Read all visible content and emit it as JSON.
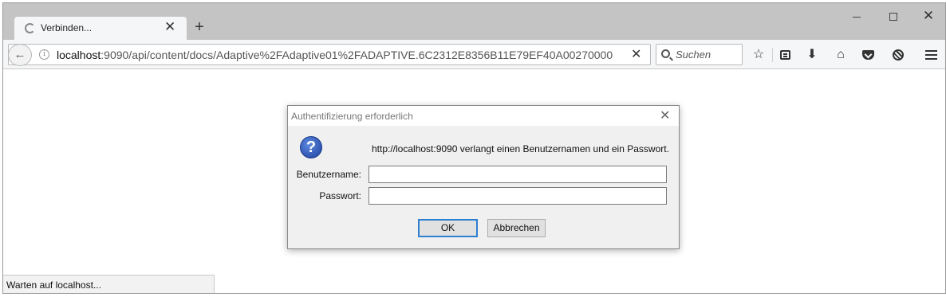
{
  "browser": {
    "tab": {
      "title": "Verbinden...",
      "favicon": "loading-throbber-icon"
    },
    "new_tab_symbol": "+",
    "window_controls": {
      "minimize": "minimize-icon",
      "maximize": "maximize-icon",
      "close_symbol": "✕"
    },
    "url": {
      "host": "localhost",
      "rest": ":9090/api/content/docs/Adaptive%2FAdaptive01%2FADAPTIVE.6C2312E8356B11E79EF40A00270000"
    },
    "back_symbol": "←",
    "info_symbol": "i",
    "stop_symbol": "✕",
    "search": {
      "placeholder": "Suchen"
    },
    "toolbar": {
      "star_symbol": "☆",
      "download_symbol": "⬇",
      "home_symbol": "⌂"
    },
    "status": "Warten auf localhost..."
  },
  "dialog": {
    "title": "Authentifizierung erforderlich",
    "close_symbol": "✕",
    "icon_symbol": "?",
    "message": "http://localhost:9090 verlangt einen Benutzernamen und ein Passwort.",
    "username_label": "Benutzername:",
    "username_value": "",
    "password_label": "Passwort:",
    "password_value": "",
    "ok_label": "OK",
    "cancel_label": "Abbrechen"
  },
  "colors": {
    "tabstrip": "#c4c4c4",
    "toolbar": "#f5f6f7",
    "dialog_bg": "#f0f0f0",
    "ok_focus_border": "#2f7fd0",
    "question_icon": "#1d3f9e"
  }
}
